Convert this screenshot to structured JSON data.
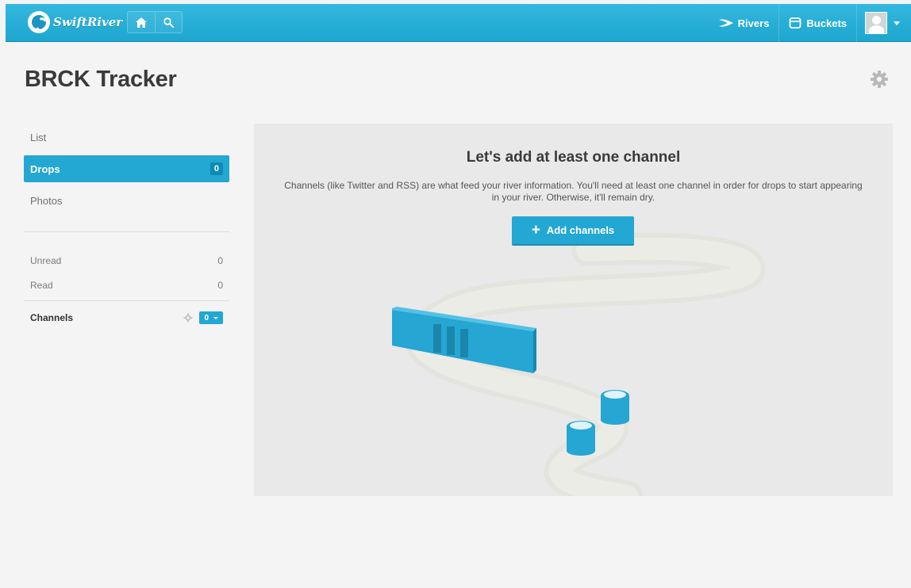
{
  "header": {
    "logo_text": "SwiftRiver",
    "nav": {
      "home_icon": "home-icon",
      "search_icon": "search-icon"
    },
    "rivers_label": "Rivers",
    "buckets_label": "Buckets",
    "avatar": "user-avatar"
  },
  "page": {
    "title": "BRCK Tracker"
  },
  "sidebar": {
    "items": [
      {
        "label": "List"
      },
      {
        "label": "Drops",
        "count": "0"
      },
      {
        "label": "Photos"
      }
    ],
    "stats": [
      {
        "label": "Unread",
        "value": "0"
      },
      {
        "label": "Read",
        "value": "0"
      }
    ],
    "channels": {
      "label": "Channels",
      "count": "0"
    }
  },
  "main": {
    "title": "Let's add at least one channel",
    "description": "Channels (like Twitter and RSS) are what feed your river information. You'll need at least one channel in order for drops to start appearing in your river. Otherwise, it'll remain dry.",
    "add_button": "Add channels"
  },
  "colors": {
    "accent": "#23a7d3",
    "topbar": "#29aed7"
  }
}
